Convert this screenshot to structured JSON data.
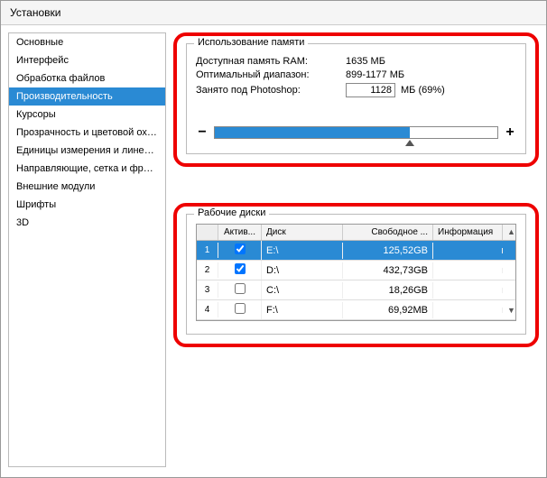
{
  "title": "Установки",
  "sidebar": {
    "items": [
      {
        "label": "Основные"
      },
      {
        "label": "Интерфейс"
      },
      {
        "label": "Обработка файлов"
      },
      {
        "label": "Производительность"
      },
      {
        "label": "Курсоры"
      },
      {
        "label": "Прозрачность и цветовой охват"
      },
      {
        "label": "Единицы измерения и линейки"
      },
      {
        "label": "Направляющие, сетка и фрагменты"
      },
      {
        "label": "Внешние модули"
      },
      {
        "label": "Шрифты"
      },
      {
        "label": "3D"
      }
    ],
    "selected_index": 3
  },
  "memory": {
    "legend": "Использование памяти",
    "available_label": "Доступная память RAM:",
    "available_value": "1635 МБ",
    "range_label": "Оптимальный диапазон:",
    "range_value": "899-1177 МБ",
    "used_label": "Занято под Photoshop:",
    "used_value": "1128",
    "used_unit": "МБ (69%)",
    "minus": "−",
    "plus": "+",
    "slider_percent": 69
  },
  "disks": {
    "legend": "Рабочие диски",
    "headers": {
      "active": "Актив...",
      "disk": "Диск",
      "free": "Свободное ...",
      "info": "Информация"
    },
    "rows": [
      {
        "idx": "1",
        "active": true,
        "disk": "E:\\",
        "free": "125,52GB",
        "info": ""
      },
      {
        "idx": "2",
        "active": true,
        "disk": "D:\\",
        "free": "432,73GB",
        "info": ""
      },
      {
        "idx": "3",
        "active": false,
        "disk": "C:\\",
        "free": "18,26GB",
        "info": ""
      },
      {
        "idx": "4",
        "active": false,
        "disk": "F:\\",
        "free": "69,92MB",
        "info": ""
      }
    ],
    "selected_row": 0
  }
}
